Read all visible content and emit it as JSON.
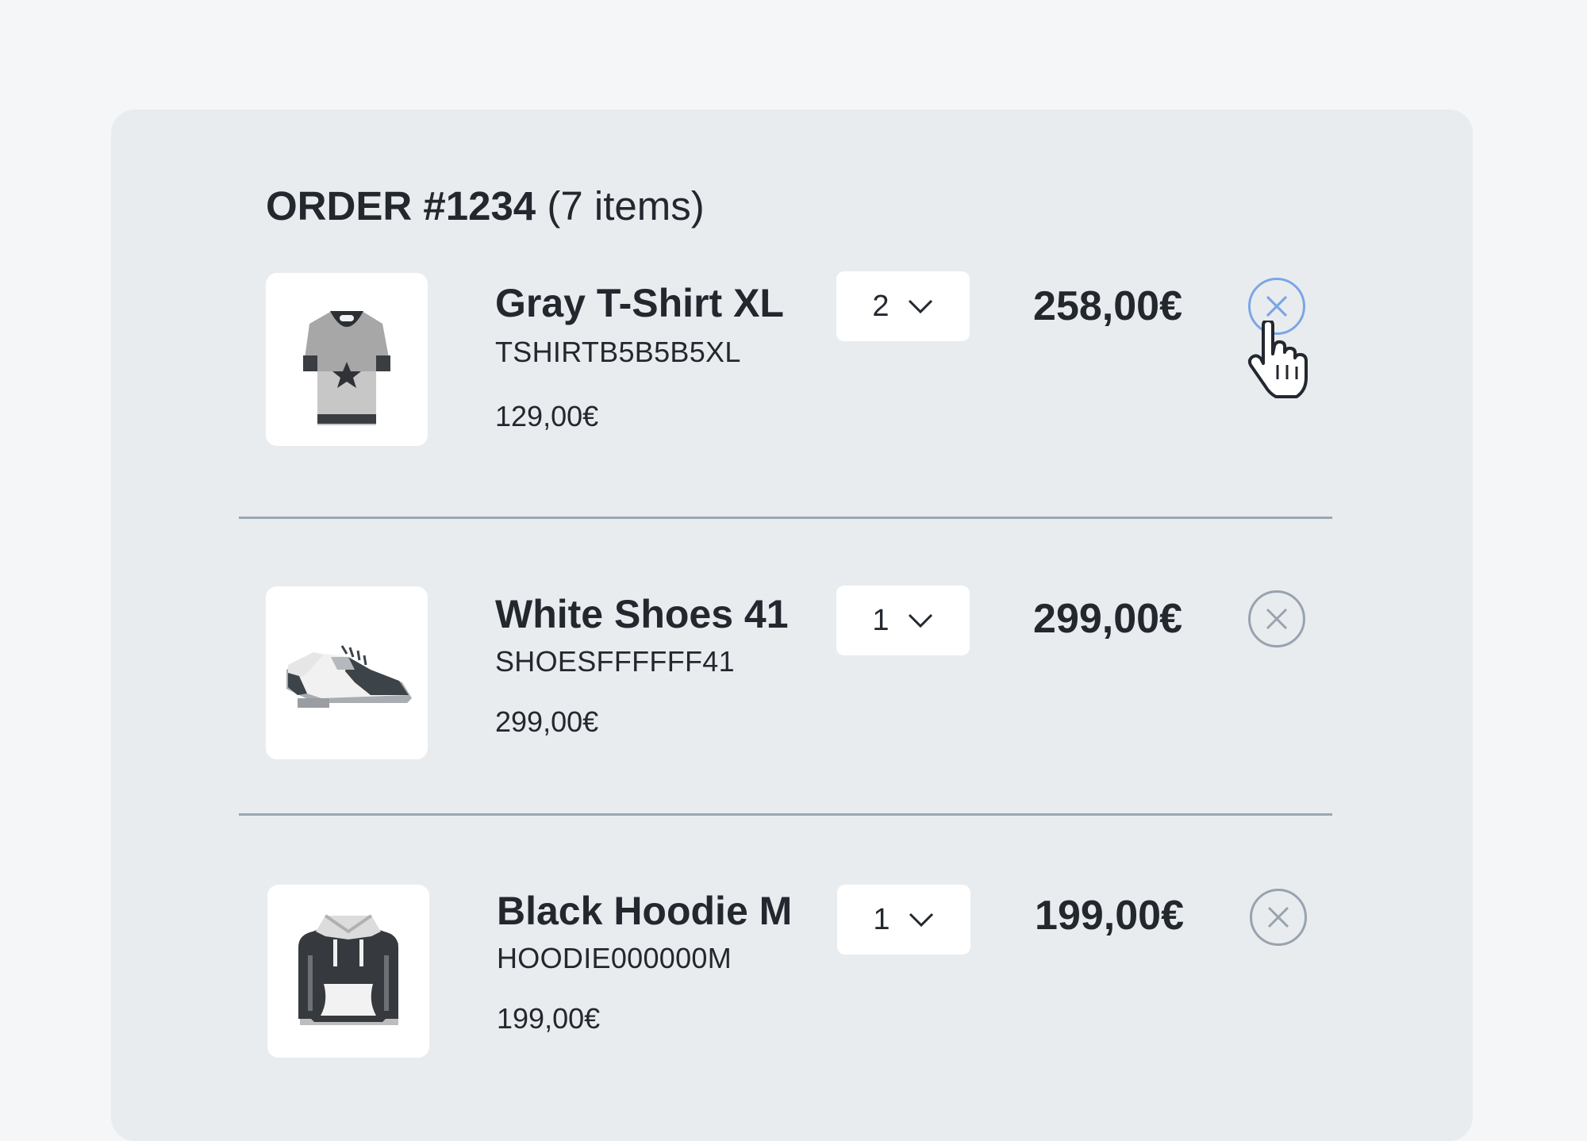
{
  "order": {
    "title_prefix": "ORDER #1234",
    "title_suffix": " (7 items)"
  },
  "items": [
    {
      "name": "Gray T-Shirt XL",
      "sku": "TSHIRTB5B5B5XL",
      "unit_price": "129,00€",
      "quantity": "2",
      "line_total": "258,00€",
      "image_icon": "gray-tshirt-icon",
      "remove_state": "hovered"
    },
    {
      "name": "White Shoes 41",
      "sku": "SHOESFFFFFF41",
      "unit_price": "299,00€",
      "quantity": "1",
      "line_total": "299,00€",
      "image_icon": "white-shoe-icon",
      "remove_state": "default"
    },
    {
      "name": "Black Hoodie M",
      "sku": "HOODIE000000M",
      "unit_price": "199,00€",
      "quantity": "1",
      "line_total": "199,00€",
      "image_icon": "black-hoodie-icon",
      "remove_state": "default"
    }
  ],
  "colors": {
    "page_background": "#f5f6f8",
    "card_background": "#e9ecef",
    "text": "#23282f",
    "divider": "#9aa7b5",
    "remove_default": "#98a3af",
    "remove_hover": "#7ba6e6"
  }
}
